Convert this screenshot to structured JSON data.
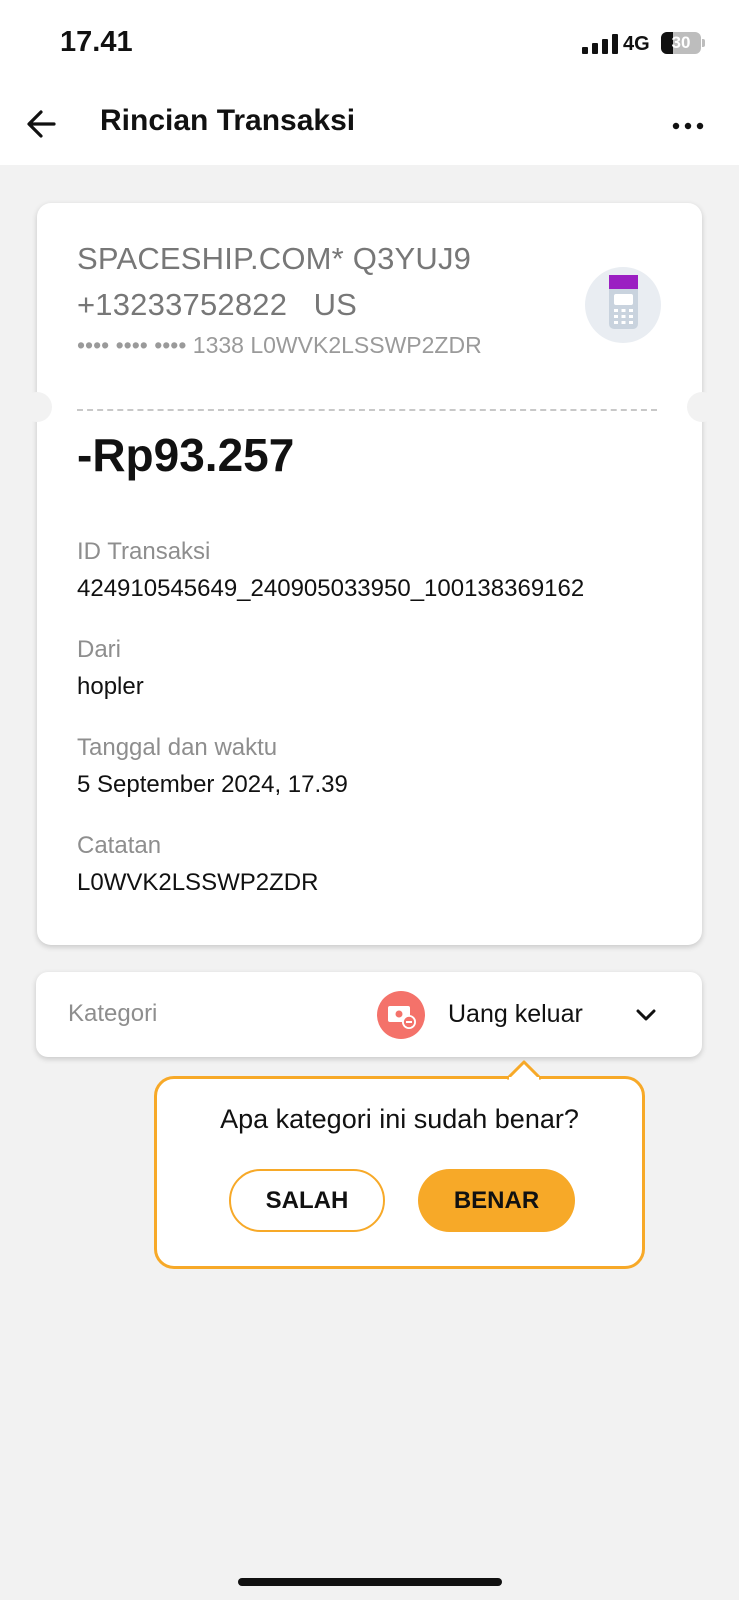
{
  "status_bar": {
    "time": "17.41",
    "network": "4G",
    "battery": "30",
    "battery_level": 0.3
  },
  "header": {
    "title": "Rincian Transaksi",
    "back_icon": "arrow-left-icon",
    "more_icon": "more-horizontal-icon"
  },
  "transaction": {
    "merchant_line1": "SPACESHIP.COM* Q3YUJ9",
    "merchant_line2": "+13233752822   US",
    "card_number": "•••• •••• •••• 1338 L0WVK2LSSWP2ZDR",
    "amount": "-Rp93.257",
    "merchant_icon": "edc-terminal-icon",
    "details": [
      {
        "label": "ID Transaksi",
        "value": "424910545649_240905033950_100138369162"
      },
      {
        "label": "Dari",
        "value": "hopler"
      },
      {
        "label": "Tanggal dan waktu",
        "value": "5 September 2024, 17.39"
      },
      {
        "label": "Catatan",
        "value": "L0WVK2LSSWP2ZDR"
      }
    ]
  },
  "category": {
    "label": "Kategori",
    "value": "Uang keluar",
    "icon": "money-out-icon",
    "icon_color": "#f4726a"
  },
  "prompt": {
    "question": "Apa kategori ini sudah benar?",
    "wrong_button": "SALAH",
    "correct_button": "BENAR",
    "accent_color": "#f7a928"
  }
}
